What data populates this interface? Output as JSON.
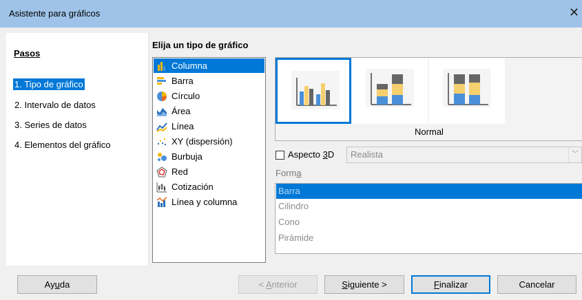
{
  "window": {
    "title": "Asistente para gráficos",
    "close_glyph": "✕"
  },
  "steps": {
    "heading": "Pasos",
    "items": [
      {
        "label": "1. Tipo de gráfico",
        "selected": true
      },
      {
        "label": "2. Intervalo de datos"
      },
      {
        "label": "3. Series de datos"
      },
      {
        "label": "4. Elementos del gráfico"
      }
    ]
  },
  "chart_type": {
    "heading": "Elija un tipo de gráfico",
    "types": [
      {
        "label": "Columna",
        "icon": "column-chart-icon",
        "selected": true
      },
      {
        "label": "Barra",
        "icon": "bar-chart-icon"
      },
      {
        "label": "Círculo",
        "icon": "pie-chart-icon"
      },
      {
        "label": "Área",
        "icon": "area-chart-icon"
      },
      {
        "label": "Línea",
        "icon": "line-chart-icon"
      },
      {
        "label": "XY (dispersión)",
        "icon": "scatter-chart-icon"
      },
      {
        "label": "Burbuja",
        "icon": "bubble-chart-icon"
      },
      {
        "label": "Red",
        "icon": "net-chart-icon"
      },
      {
        "label": "Cotización",
        "icon": "stock-chart-icon"
      },
      {
        "label": "Línea y columna",
        "icon": "column-line-chart-icon"
      }
    ],
    "variants": [
      {
        "name": "normal",
        "icon": "column-normal-icon",
        "selected": true
      },
      {
        "name": "stacked",
        "icon": "column-stacked-icon"
      },
      {
        "name": "percent-stacked",
        "icon": "column-percent-stacked-icon"
      }
    ],
    "variant_caption": "Normal"
  },
  "options_3d": {
    "label_pre": "Aspecto ",
    "label_accel": "3",
    "label_post": "D",
    "checked": false,
    "scheme_value": "Realista",
    "combo_arrow": "﹀"
  },
  "shape": {
    "label_pre": "Form",
    "label_accel": "a",
    "items": [
      {
        "label": "Barra",
        "selected": true
      },
      {
        "label": "Cilindro"
      },
      {
        "label": "Cono"
      },
      {
        "label": "Pirámide"
      }
    ]
  },
  "buttons": {
    "help": {
      "pre": "Ay",
      "accel": "u",
      "post": "da"
    },
    "back": {
      "pre": "< ",
      "accel": "A",
      "post": "nterior"
    },
    "next": {
      "pre": "",
      "accel": "S",
      "post": "iguiente >"
    },
    "finish": {
      "pre": "",
      "accel": "F",
      "post": "inalizar"
    },
    "cancel": {
      "pre": "Cancelar",
      "accel": "",
      "post": ""
    }
  },
  "colors": {
    "accent": "#0078d7",
    "titlebar": "#9fc3e8"
  }
}
